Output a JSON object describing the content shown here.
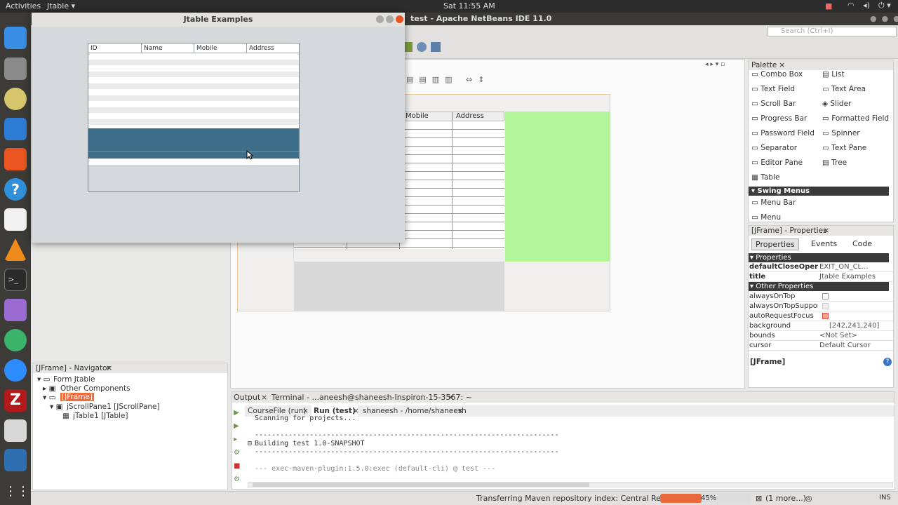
{
  "topbar": {
    "activities": "Activities",
    "app_menu": "Jtable",
    "clock": "Sat 11:55 AM"
  },
  "ide": {
    "title": "test - Apache NetBeans IDE 11.0",
    "search_placeholder": "Search (Ctrl+I)"
  },
  "jframe": {
    "title": "Jtable Examples",
    "columns": [
      "ID",
      "Name",
      "Mobile",
      "Address"
    ]
  },
  "designer": {
    "visible_headers": [
      "Mobile",
      "Address"
    ]
  },
  "palette": {
    "tab": "Palette",
    "items": [
      [
        "Combo Box",
        "List"
      ],
      [
        "Text Field",
        "Text Area"
      ],
      [
        "Scroll Bar",
        "Slider"
      ],
      [
        "Progress Bar",
        "Formatted Field"
      ],
      [
        "Password Field",
        "Spinner"
      ],
      [
        "Separator",
        "Text Pane"
      ],
      [
        "Editor Pane",
        "Tree"
      ],
      [
        "Table",
        ""
      ]
    ],
    "section": "Swing Menus",
    "menu_items": [
      "Menu Bar",
      "Menu"
    ]
  },
  "props": {
    "tab": "[JFrame] - Properties",
    "tabs": [
      "Properties",
      "Events",
      "Code"
    ],
    "section1": "Properties",
    "rows1": [
      [
        "defaultCloseOperation",
        "EXIT_ON_CL..."
      ],
      [
        "title",
        "Jtable Examples"
      ]
    ],
    "section2": "Other Properties",
    "rows2": [
      [
        "alwaysOnTop",
        ""
      ],
      [
        "alwaysOnTopSupported",
        ""
      ],
      [
        "autoRequestFocus",
        ""
      ],
      [
        "background",
        "[242,241,240]"
      ],
      [
        "bounds",
        "<Not Set>"
      ],
      [
        "cursor",
        "Default Cursor"
      ]
    ],
    "footer": "[JFrame]"
  },
  "nav": {
    "tab": "[JFrame] - Navigator",
    "items": [
      "Form Jtable",
      "Other Components",
      "[JFrame]",
      "jScrollPane1 [JScrollPane]",
      "jTable1 [JTable]"
    ]
  },
  "output": {
    "tabs": [
      "Output",
      "Terminal - ...aneesh@shaneesh-Inspiron-15-3567: ~"
    ],
    "subtabs": [
      "CourseFile (run)",
      "Run (test)",
      "shaneesh - /home/shaneesh"
    ],
    "lines": [
      "Scanning for projects...",
      "",
      "------------------------------------------------------------------------",
      "Building test 1.0-SNAPSHOT",
      "------------------------------------------------------------------------",
      "",
      "--- exec-maven-plugin:1.5.0:exec (default-cli) @ test ---"
    ]
  },
  "status": {
    "text": "Transferring Maven repository index: Central Repository",
    "progress": "45%",
    "progress_value": 0.45,
    "more": "(1 more...)",
    "mode": "INS"
  }
}
